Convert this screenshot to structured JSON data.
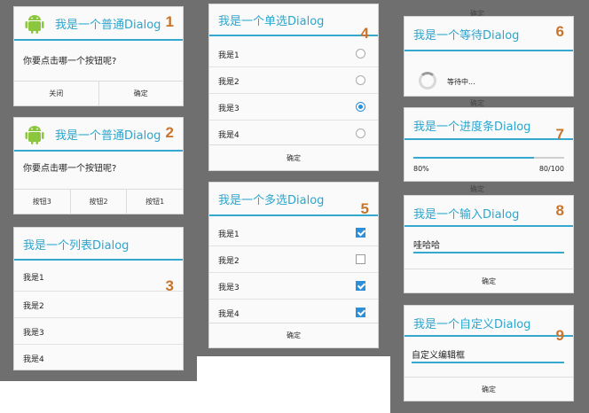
{
  "dialog1": {
    "title": "我是一个普通Dialog",
    "number": "1",
    "message": "你要点击哪一个按钮呢?",
    "buttons": [
      "关闭",
      "确定"
    ]
  },
  "dialog2": {
    "title": "我是一个普通Dialog",
    "number": "2",
    "message": "你要点击哪一个按钮呢?",
    "buttons": [
      "按钮3",
      "按钮2",
      "按钮1"
    ]
  },
  "dialog3": {
    "title": "我是一个列表Dialog",
    "number": "3",
    "items": [
      "我是1",
      "我是2",
      "我是3",
      "我是4"
    ]
  },
  "dialog4": {
    "title": "我是一个单选Dialog",
    "number": "4",
    "items": [
      "我是1",
      "我是2",
      "我是3",
      "我是4"
    ],
    "selected_index": 2,
    "button": "确定"
  },
  "dialog5": {
    "title": "我是一个多选Dialog",
    "number": "5",
    "items": [
      "我是1",
      "我是2",
      "我是3",
      "我是4"
    ],
    "checked": [
      true,
      false,
      true,
      true
    ],
    "button": "确定"
  },
  "dialog6": {
    "title": "我是一个等待Dialog",
    "number": "6",
    "message": "等待中..."
  },
  "dialog7": {
    "title": "我是一个进度条Dialog",
    "number": "7",
    "percent_text": "80%",
    "ratio_text": "80/100",
    "progress": 0.8
  },
  "dialog8": {
    "title": "我是一个输入Dialog",
    "number": "8",
    "value": "哇哈哈",
    "button": "确定"
  },
  "dialog9": {
    "title": "我是一个自定义Dialog",
    "number": "9",
    "value": "自定义编辑框",
    "button": "确定"
  },
  "ghost_texts": [
    "确定",
    "确定",
    "确定"
  ],
  "colors": {
    "accent": "#35a8d0",
    "number": "#c8742b",
    "title_text": "#2aa6cf",
    "check": "#2b90d9"
  }
}
